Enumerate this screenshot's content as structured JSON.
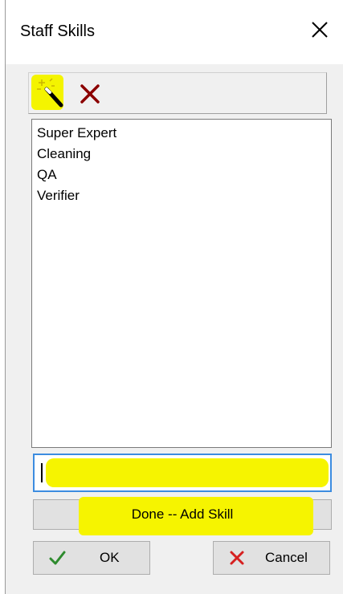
{
  "window": {
    "title": "Staff Skills",
    "close_icon": "close-icon"
  },
  "toolbar": {
    "add_icon": "magic-wand-icon",
    "delete_icon": "delete-x-icon"
  },
  "skills_list": {
    "items": [
      "Super Expert",
      "Cleaning",
      "QA",
      "Verifier"
    ]
  },
  "skill_input": {
    "value": "",
    "placeholder": ""
  },
  "buttons": {
    "done_add_skill": "Done -- Add Skill",
    "ok": "OK",
    "cancel": "Cancel"
  },
  "colors": {
    "highlight": "#f6f400",
    "ok_check": "#2e8b2e",
    "cancel_x": "#d62020",
    "delete_x": "#8b0000",
    "focus_border": "#3c8ce0"
  }
}
